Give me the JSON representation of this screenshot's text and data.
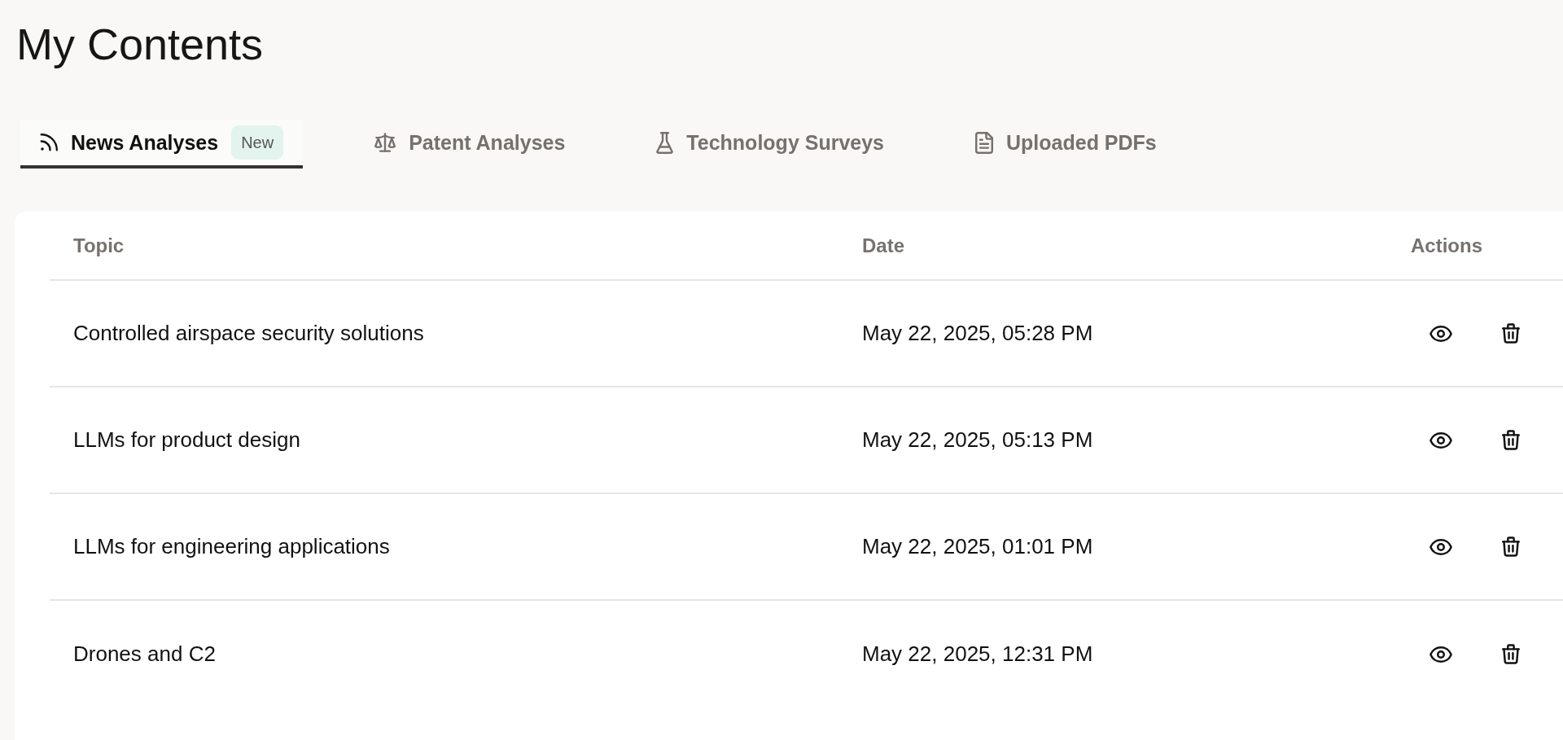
{
  "page": {
    "title": "My Contents"
  },
  "tabs": [
    {
      "label": "News Analyses",
      "badge": "New",
      "selected": true
    },
    {
      "label": "Patent Analyses",
      "selected": false
    },
    {
      "label": "Technology Surveys",
      "selected": false
    },
    {
      "label": "Uploaded PDFs",
      "selected": false
    }
  ],
  "table": {
    "columns": [
      "Topic",
      "Date",
      "Actions"
    ],
    "rows": [
      {
        "topic": "Controlled airspace security solutions",
        "date": "May 22, 2025, 05:28 PM"
      },
      {
        "topic": "LLMs for product design",
        "date": "May 22, 2025, 05:13 PM"
      },
      {
        "topic": "LLMs for engineering applications",
        "date": "May 22, 2025, 01:01 PM"
      },
      {
        "topic": "Drones and C2",
        "date": "May 22, 2025, 12:31 PM"
      }
    ]
  }
}
